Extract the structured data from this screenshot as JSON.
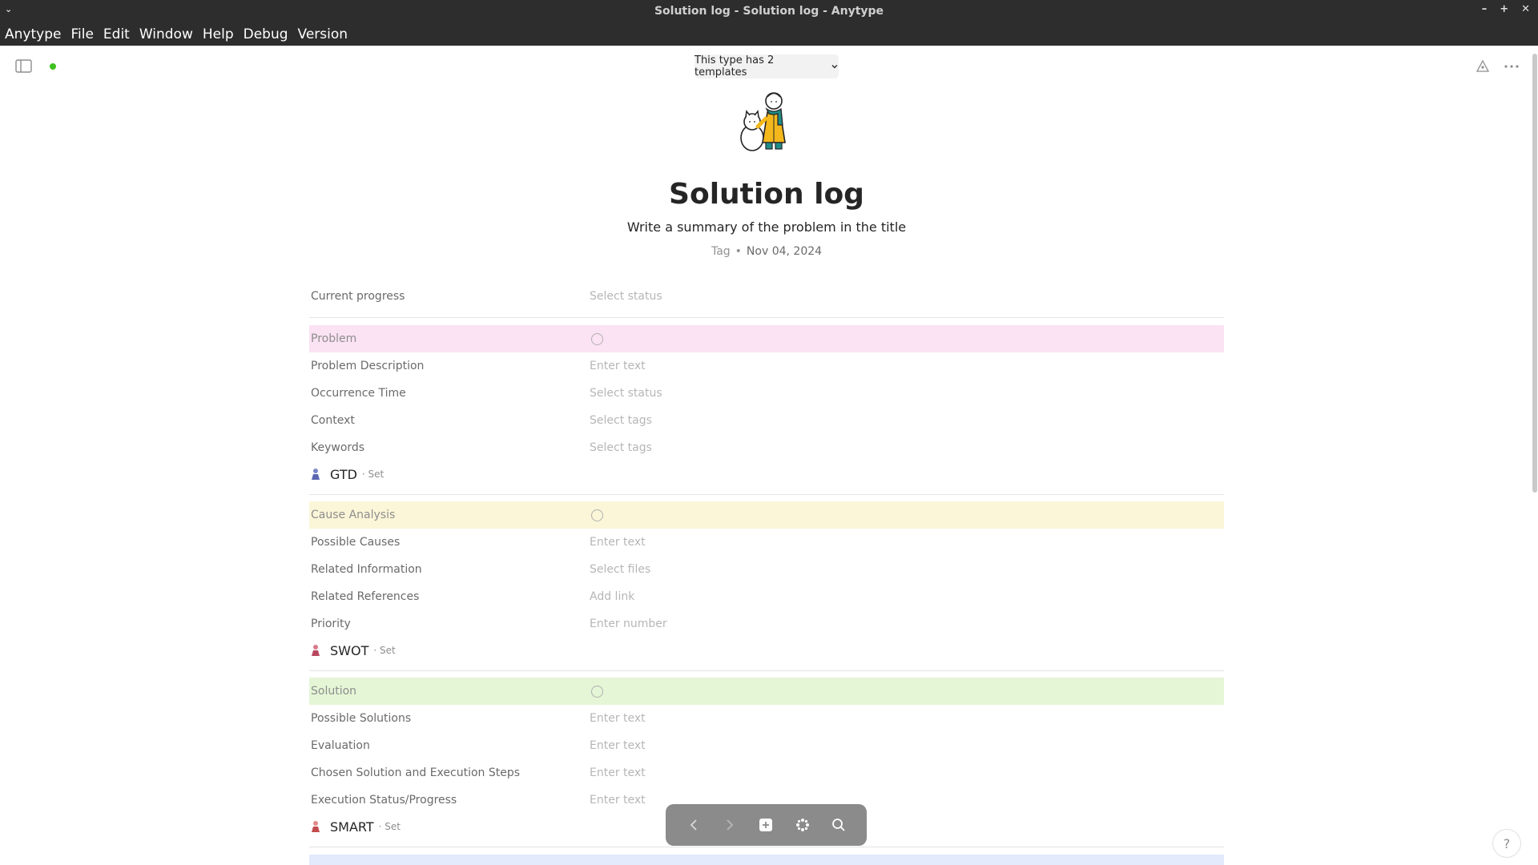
{
  "window": {
    "title": "Solution log - Solution log - Anytype"
  },
  "menu": [
    "Anytype",
    "File",
    "Edit",
    "Window",
    "Help",
    "Debug",
    "Version"
  ],
  "header": {
    "template_label": "This type has 2 templates"
  },
  "page": {
    "title": "Solution log",
    "description": "Write a summary of the problem in the title",
    "tag_label": "Tag",
    "date": "Nov 04, 2024"
  },
  "relations": {
    "current_progress": {
      "name": "Current progress",
      "value": "Select status"
    },
    "problem": {
      "name": "Problem",
      "color": "#fbe3f3"
    },
    "problem_description": {
      "name": "Problem Description",
      "value": "Enter text"
    },
    "occurrence_time": {
      "name": "Occurrence Time",
      "value": "Select status"
    },
    "context": {
      "name": "Context",
      "value": "Select tags"
    },
    "keywords": {
      "name": "Keywords",
      "value": "Select tags"
    },
    "set_gtd": {
      "name": "GTD",
      "type": "· Set",
      "icon": "person-icon"
    },
    "cause_analysis": {
      "name": "Cause Analysis",
      "color": "#fbf6d8"
    },
    "possible_causes": {
      "name": "Possible Causes",
      "value": "Enter text"
    },
    "related_information": {
      "name": "Related Information",
      "value": "Select files"
    },
    "related_references": {
      "name": "Related References",
      "value": "Add link"
    },
    "priority": {
      "name": "Priority",
      "value": "Enter number"
    },
    "set_swot": {
      "name": "SWOT",
      "type": "· Set",
      "icon": "person-icon"
    },
    "solution": {
      "name": "Solution",
      "color": "#e5f6d6"
    },
    "possible_solutions": {
      "name": "Possible Solutions",
      "value": "Enter text"
    },
    "evaluation": {
      "name": "Evaluation",
      "value": "Enter text"
    },
    "chosen_solution": {
      "name": "Chosen Solution and Execution Steps",
      "value": "Enter text"
    },
    "execution_status": {
      "name": "Execution Status/Progress",
      "value": "Enter text"
    },
    "set_smart": {
      "name": "SMART",
      "type": "· Set",
      "icon": "person-icon"
    },
    "reflection_color": "#e2eafb"
  },
  "help_label": "?"
}
